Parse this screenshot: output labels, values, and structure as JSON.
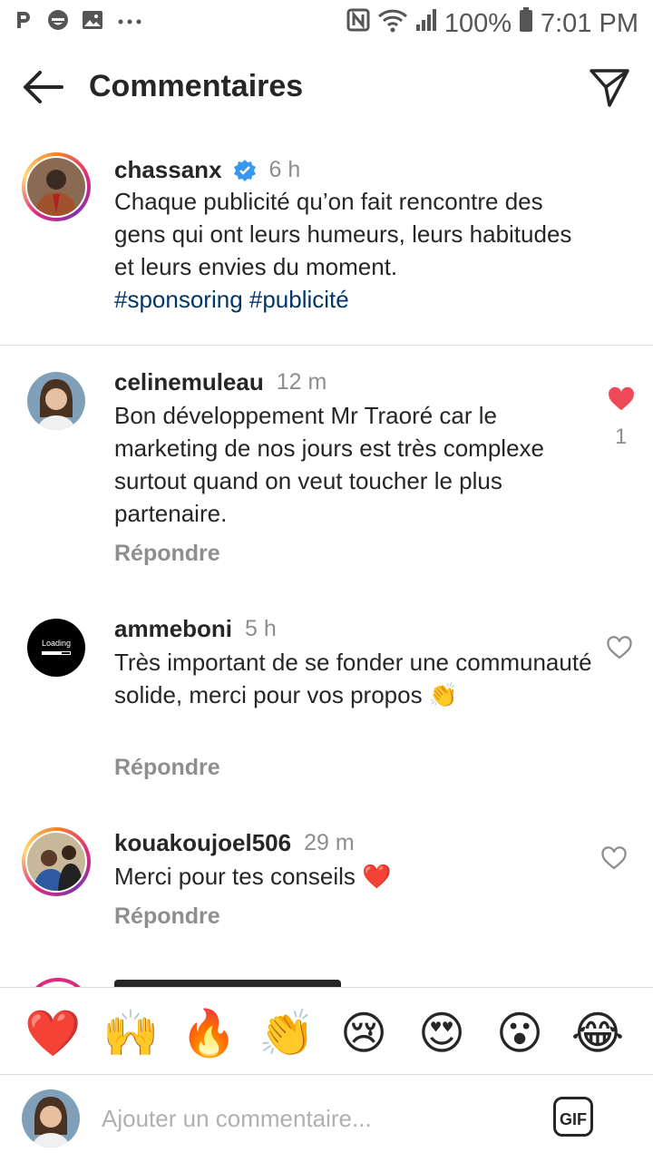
{
  "status_bar": {
    "left_icons": [
      "p-icon",
      "face-icon",
      "image-icon",
      "more-dots-icon"
    ],
    "battery": "100%",
    "time": "7:01 PM"
  },
  "header": {
    "title": "Commentaires"
  },
  "caption": {
    "username": "chassanx",
    "verified": true,
    "time": "6 h",
    "text": "Chaque publicité qu’on fait rencontre des gens qui ont leurs humeurs, leurs habitudes et leurs envies du moment.",
    "hashtags": "#sponsoring #publicité"
  },
  "comments": [
    {
      "username": "celinemuleau",
      "time": "12 m",
      "text": "Bon développement Mr Traoré car le marketing de nos jours est très complexe surtout quand on veut toucher le plus partenaire.",
      "reply": "Répondre",
      "liked": true,
      "likes": "1"
    },
    {
      "username": "ammeboni",
      "time": "5 h",
      "text": "Très important de se fonder une communauté solide, merci pour vos propos 👏",
      "reply": "Répondre",
      "liked": false,
      "avatar_text": "Loading"
    },
    {
      "username": "kouakoujoel506",
      "time": "29 m",
      "text": "Merci pour tes conseils ❤️",
      "reply": "Répondre",
      "liked": false
    }
  ],
  "emoji_bar": [
    "❤️",
    "🙌",
    "🔥",
    "👏",
    "😢",
    "😍",
    "😮",
    "😂"
  ],
  "input": {
    "placeholder": "Ajouter un commentaire...",
    "gif_label": "GIF"
  },
  "colors": {
    "hashtag": "#00376b",
    "like_red": "#ed4956",
    "verified": "#3897f0",
    "muted": "#8e8e8e"
  }
}
